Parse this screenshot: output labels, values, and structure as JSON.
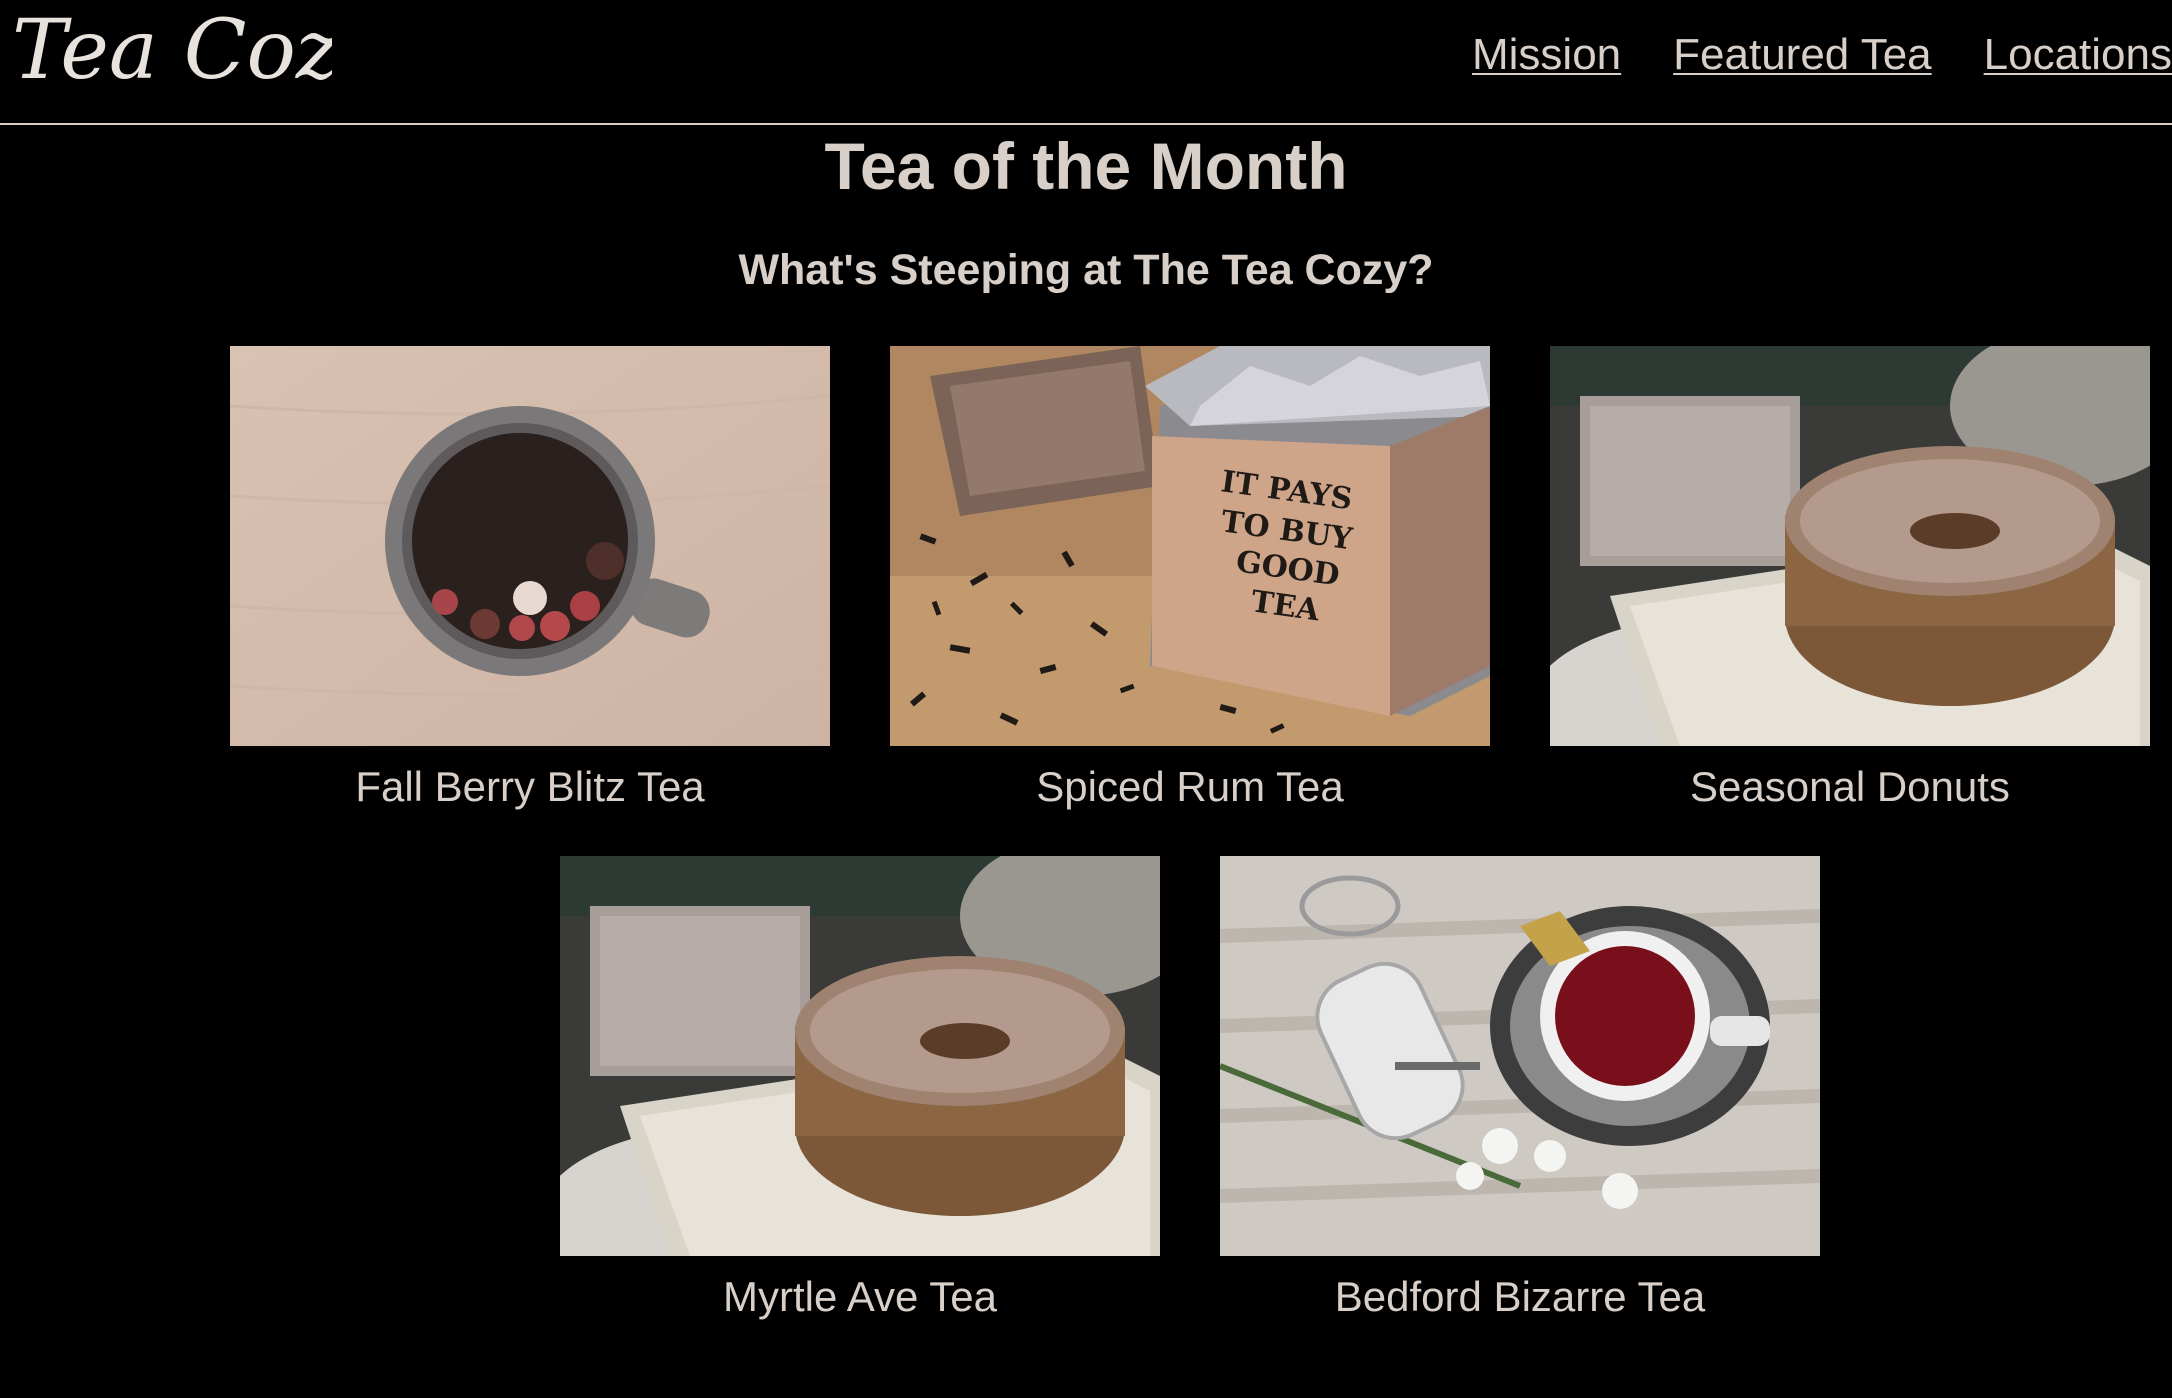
{
  "header": {
    "logo_text": "Tea Cozy",
    "nav": [
      {
        "label": "Mission"
      },
      {
        "label": "Featured Tea"
      },
      {
        "label": "Locations"
      }
    ]
  },
  "main": {
    "title": "Tea of the Month",
    "subtitle": "What's Steeping at The Tea Cozy?",
    "items": [
      {
        "caption": "Fall Berry Blitz Tea",
        "image": "mug-of-berry-tea"
      },
      {
        "caption": "Spiced Rum Tea",
        "image": "tea-box-it-pays-to-buy-good-tea"
      },
      {
        "caption": "Seasonal Donuts",
        "image": "sugared-donut-on-plate"
      },
      {
        "caption": "Myrtle Ave Tea",
        "image": "sugared-donut-on-plate"
      },
      {
        "caption": "Bedford Bizarre Tea",
        "image": "red-tea-cup-and-glass-jar"
      }
    ],
    "box_lettering": [
      "IT PAYS",
      "TO BUY",
      "GOOD",
      "TEA"
    ]
  },
  "colors": {
    "background": "#000000",
    "text": "#d8cfc8"
  }
}
